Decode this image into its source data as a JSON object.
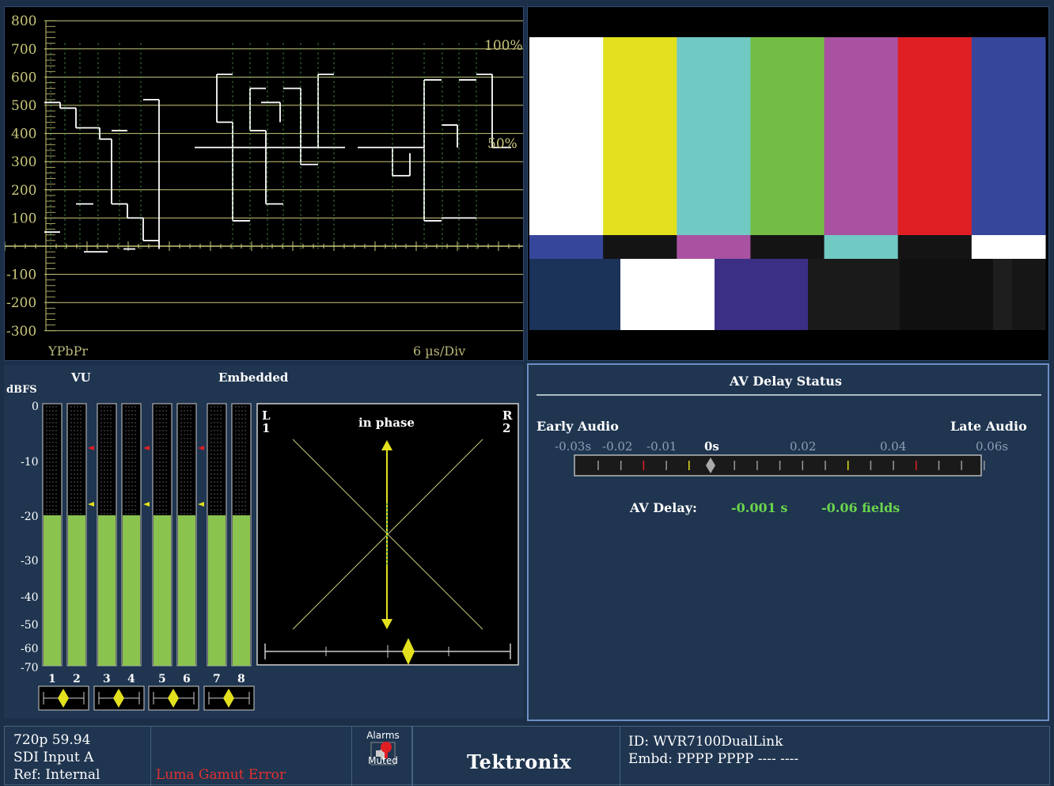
{
  "waveform": {
    "y_ticks": [
      "800",
      "700",
      "600",
      "500",
      "400",
      "300",
      "200",
      "100",
      "-100",
      "-200",
      "-300"
    ],
    "pct_100": "100%",
    "pct_50": "50%",
    "mode_label": "YPbPr",
    "sweep_label": "6 µs/Div",
    "colors": {
      "grid": "#c8c77a",
      "trace": "#ffffff",
      "dots": "#4fa84f"
    }
  },
  "picture": {
    "main_bars": [
      "#ffffff",
      "#e3e11e",
      "#71c9c4",
      "#74bd44",
      "#a852a1",
      "#e01f25",
      "#36479b"
    ],
    "mid_bars": [
      "#36479b",
      "#141414",
      "#a852a1",
      "#141414",
      "#71c9c4",
      "#141414",
      "#ffffff"
    ],
    "pluge": [
      "#1b3259",
      "#ffffff",
      "#3b2e85",
      "#1a1a1a",
      "#101010",
      "#1e1e1e",
      "#161616"
    ]
  },
  "audio": {
    "vu_label": "VU",
    "embedded_label": "Embedded",
    "dbfs_label": "dBFS",
    "scale": [
      "0",
      "-10",
      "-20",
      "-30",
      "-40",
      "-50",
      "-60",
      "-70"
    ],
    "channels": [
      "1",
      "2",
      "3",
      "4",
      "5",
      "6",
      "7",
      "8"
    ],
    "level_dbfs": -20,
    "lissajous": {
      "left_label": "L",
      "left_num": "1",
      "right_label": "R",
      "right_num": "2",
      "phase_text": "in phase"
    }
  },
  "av_delay": {
    "title": "AV Delay Status",
    "early_label": "Early Audio",
    "late_label": "Late Audio",
    "scale": [
      "-0.03s",
      "-0.02",
      "-0.01",
      "0s",
      "0.02",
      "0.04",
      "0.06s"
    ],
    "delay_label": "AV Delay:",
    "delay_seconds": "-0.001 s",
    "delay_fields": "-0.06 fields"
  },
  "status_bar": {
    "format": "720p 59.94",
    "input": "SDI Input A",
    "ref": "Ref: Internal",
    "error": "Luma Gamut Error",
    "alarms_line1": "Alarms",
    "alarms_line2": "Muted",
    "brand": "Tektronix",
    "id_line": "ID: WVR7100DualLink",
    "embd_line": "Embd: PPPP PPPP ---- ----"
  }
}
